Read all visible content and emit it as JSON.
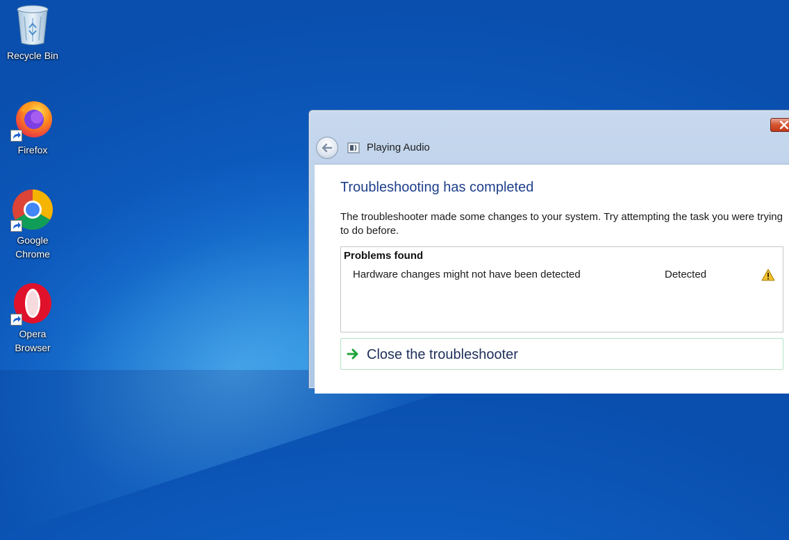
{
  "desktop": {
    "icons": [
      {
        "label": "Recycle Bin",
        "icon": "recycle-bin-icon"
      },
      {
        "label": "Firefox",
        "icon": "firefox-icon"
      },
      {
        "label": "Google Chrome",
        "icon": "chrome-icon"
      },
      {
        "label": "Opera Browser",
        "icon": "opera-icon"
      }
    ]
  },
  "window": {
    "title": "Playing Audio",
    "heading": "Troubleshooting has completed",
    "description": "The troubleshooter made some changes to your system. Try attempting the task you were trying to do before.",
    "problems": {
      "title": "Problems found",
      "rows": [
        {
          "name": "Hardware changes might not have been detected",
          "status": "Detected",
          "icon": "warning-icon"
        }
      ]
    },
    "action_label": "Close the troubleshooter"
  },
  "colors": {
    "heading": "#1e3f8a",
    "action_border": "#b3e3c5",
    "close_button": "#d6532d"
  }
}
